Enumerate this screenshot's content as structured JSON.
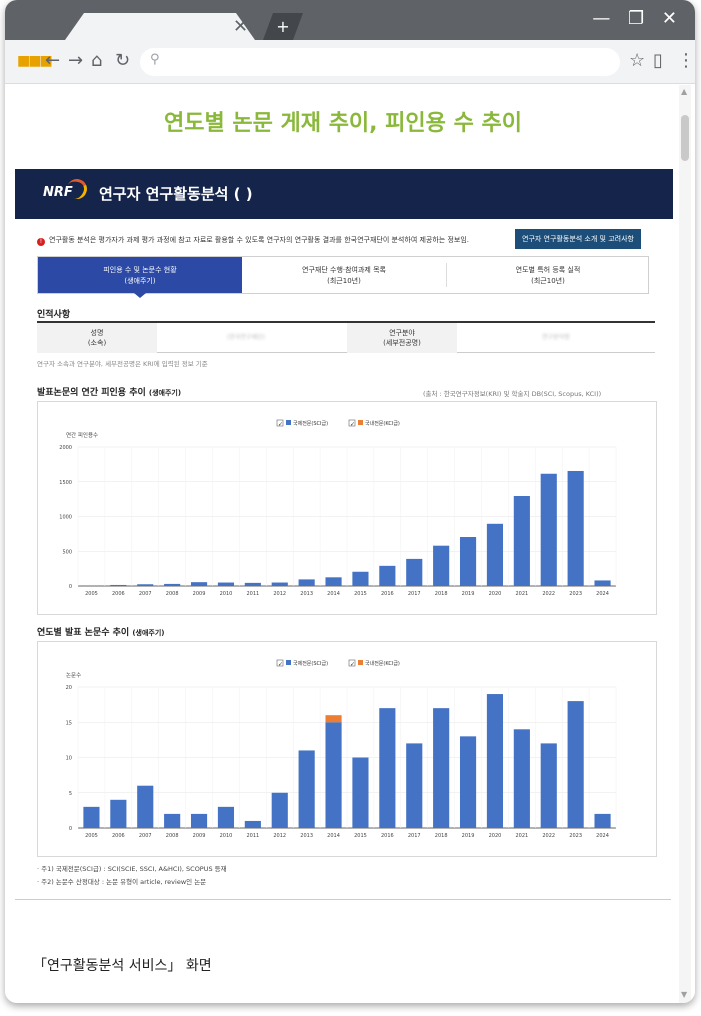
{
  "browser": {
    "tab_close": "✕",
    "new_tab": "+",
    "window_controls": "— ❐ ✕",
    "icons": [
      "apps-icon",
      "back-icon",
      "forward-icon",
      "home-icon",
      "reload-icon",
      "search-icon",
      "star-icon",
      "page-icon",
      "menu-icon"
    ]
  },
  "page": {
    "top_caption": "연도별 논문 게재 추이, 피인용 수 추이",
    "logo": "NRF",
    "header_title": "연구자 연구활동분석 (         )",
    "notice": "연구활동 분석은 평가자가 과제 평가 과정에 참고 자료로 활용할 수 있도록 연구자의 연구활동 결과를 한국연구재단이 분석하여 제공하는 정보임.",
    "notice_button": "연구자 연구활동분석 소개 및 고려사항",
    "tabs": [
      {
        "line1": "피인용 수 및 논문수 현황",
        "line2": "(생애주기)"
      },
      {
        "line1": "연구재단 수행·참여과제 목록",
        "line2": "(최근10년)"
      },
      {
        "line1": "연도별 특허 등록 실적",
        "line2": "(최근10년)"
      }
    ],
    "personal_section": "인적사항",
    "table": {
      "name_header": "성명",
      "name_header2": "(소속)",
      "name_value": "(한국연구재단)",
      "field_header": "연구분야",
      "field_header2": "(세부전공명)",
      "field_value": "연구분야명"
    },
    "table_note": "연구자 소속과 연구분야, 세부전공명은 KRI에 입력된 정보 기준",
    "chart1_title": "발표논문의 연간 피인용 추이",
    "chart1_title_suffix": "(생애주기)",
    "chart1_source": "(출처 : 한국연구자정보(KRI) 및 학술지 DB(SCI, Scopus, KCI))",
    "chart2_title": "연도별 발표 논문수 추이",
    "chart2_title_suffix": "(생애주기)",
    "note1": "· 주1) 국제전문(SCI급) : SCI(SCIE, SSCI, A&HCI), SCOPUS 등재",
    "note2": "· 주2) 논문수 산정대상 : 논문 유형이 article, review인 논문",
    "bottom_caption": "「연구활동분석 서비스」 화면"
  },
  "colors": {
    "intl": "#4472c4",
    "dom": "#ed7d31",
    "header_bg": "#14244a",
    "accent": "#8ab83a"
  },
  "chart_data": [
    {
      "type": "bar",
      "ylabel": "연간 피인용수",
      "ylim": [
        0,
        2000
      ],
      "yticks": [
        0,
        500,
        1000,
        1500,
        2000
      ],
      "categories": [
        "2005",
        "2006",
        "2007",
        "2008",
        "2009",
        "2010",
        "2011",
        "2012",
        "2013",
        "2014",
        "2015",
        "2016",
        "2017",
        "2018",
        "2019",
        "2020",
        "2021",
        "2022",
        "2023",
        "2024"
      ],
      "series": [
        {
          "name": "국제전문(SCI급)",
          "values": [
            0,
            15,
            25,
            30,
            55,
            50,
            45,
            50,
            95,
            125,
            205,
            290,
            390,
            580,
            705,
            895,
            1295,
            1615,
            1655,
            80
          ]
        },
        {
          "name": "국내전문(KCI급)",
          "values": [
            0,
            0,
            0,
            0,
            0,
            0,
            0,
            0,
            0,
            0,
            0,
            0,
            0,
            0,
            0,
            0,
            0,
            0,
            0,
            0
          ]
        }
      ]
    },
    {
      "type": "bar",
      "ylabel": "논문수",
      "ylim": [
        0,
        20
      ],
      "yticks": [
        0,
        5,
        10,
        15,
        20
      ],
      "categories": [
        "2005",
        "2006",
        "2007",
        "2008",
        "2009",
        "2010",
        "2011",
        "2012",
        "2013",
        "2014",
        "2015",
        "2016",
        "2017",
        "2018",
        "2019",
        "2020",
        "2021",
        "2022",
        "2023",
        "2024"
      ],
      "series": [
        {
          "name": "국제전문(SCI급)",
          "values": [
            3,
            4,
            6,
            2,
            2,
            3,
            1,
            5,
            11,
            15,
            10,
            17,
            12,
            17,
            13,
            19,
            14,
            12,
            18,
            2
          ]
        },
        {
          "name": "국내전문(KCI급)",
          "values": [
            0,
            0,
            0,
            0,
            0,
            0,
            0,
            0,
            0,
            1,
            0,
            0,
            0,
            0,
            0,
            0,
            0,
            0,
            0,
            0
          ]
        }
      ]
    }
  ]
}
